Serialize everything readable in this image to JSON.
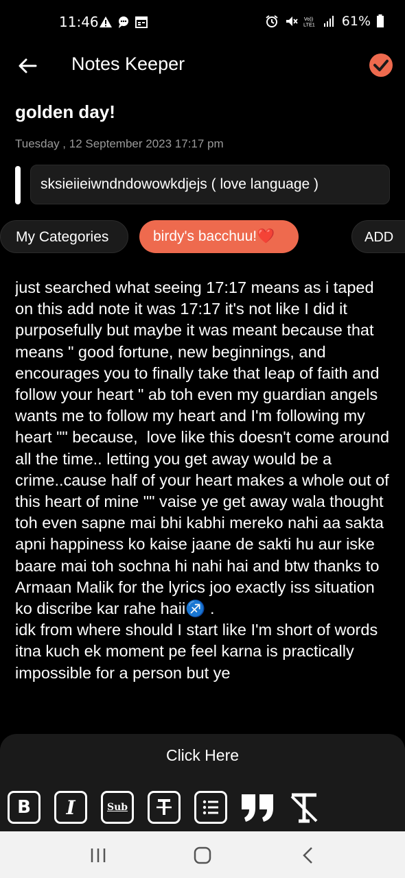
{
  "status_bar": {
    "time": "11:46",
    "battery": "61%",
    "left_icons": [
      "warning-icon",
      "chat-icon",
      "calendar-icon"
    ],
    "right_icons": [
      "alarm-icon",
      "mute-icon",
      "volte-icon",
      "signal-icon",
      "battery-icon"
    ]
  },
  "app_bar": {
    "title": "Notes Keeper",
    "accent_color": "#ee6a4e"
  },
  "note": {
    "title": "golden day!",
    "date": "Tuesday , 12 September 2023 17:17 pm",
    "subtitle": "sksieiieiwndndowowkdjejs ( love language )",
    "body": "just searched what seeing 17:17 means as i taped on this add note it was 17:17 it's not like I did it purposefully but maybe it was meant because that means \" good fortune, new beginnings, and encourages you to finally take that leap of faith and follow your heart \" ab toh even my guardian angels wants me to follow my heart and I'm following my heart \"\" because,  love like this doesn't come around all the time.. letting you get away would be a crime..cause half of your heart makes a whole out of this heart of mine \"\" vaise ye get away wala thought toh even sapne mai bhi kabhi mereko nahi aa sakta apni happiness ko kaise jaane de sakti hu aur iske baare mai toh sochna hi nahi hai and btw thanks to Armaan Malik for the lyrics joo exactly iss situation ko discribe kar rahe haii♐ .\nidk from where should I start like I'm short of words itna kuch ek moment pe feel karna is practically impossible for a person but ye"
  },
  "categories": {
    "my_categories_label": "My Categories",
    "selected_tag": "birdy's bacchuu!❤️",
    "add_label": "ADD"
  },
  "bottom_panel": {
    "click_here": "Click Here",
    "tools": [
      {
        "name": "bold-tool",
        "glyph": "B"
      },
      {
        "name": "italic-tool",
        "glyph": "I"
      },
      {
        "name": "subscript-tool",
        "glyph": "Sub"
      },
      {
        "name": "strikethrough-tool",
        "glyph": "T"
      },
      {
        "name": "list-tool",
        "glyph": "list"
      },
      {
        "name": "quote-tool",
        "glyph": "quote"
      },
      {
        "name": "clear-format-tool",
        "glyph": "clear"
      }
    ]
  },
  "nav_bar": {
    "buttons": [
      "recents-icon",
      "home-icon",
      "back-nav-icon"
    ]
  }
}
